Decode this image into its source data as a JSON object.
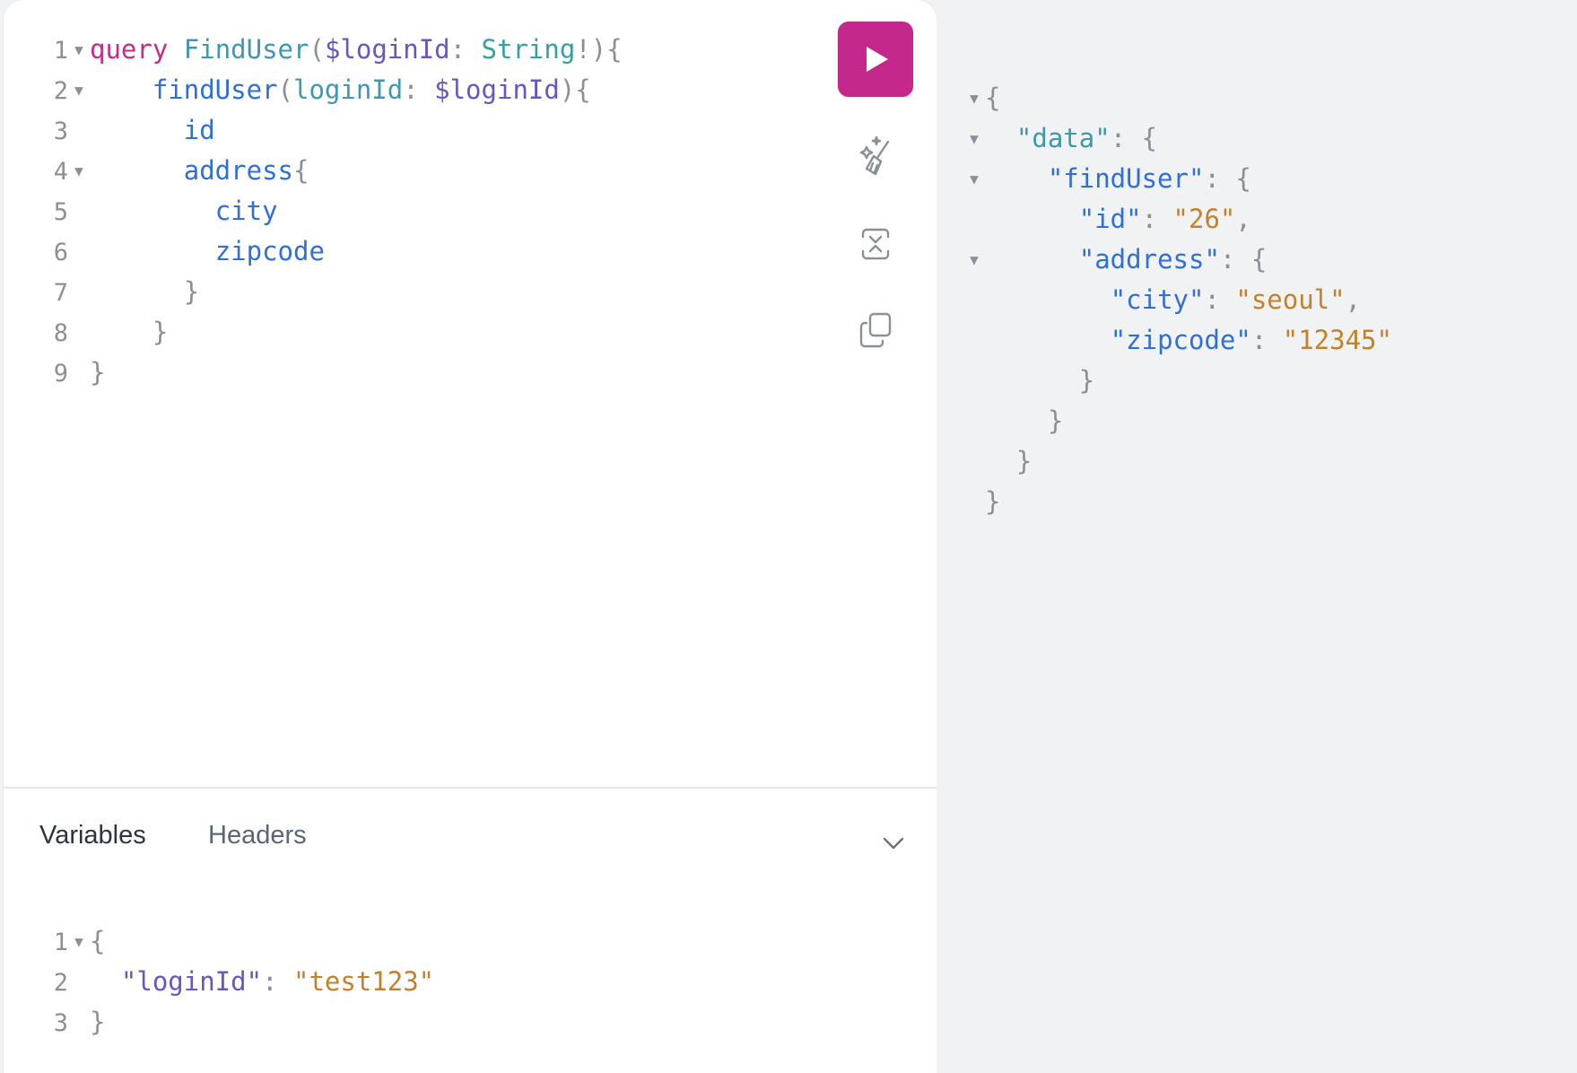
{
  "query_editor": {
    "lines": [
      {
        "n": "1",
        "fold": true,
        "tokens": [
          [
            "kw",
            "query"
          ],
          [
            "plain",
            " "
          ],
          [
            "def",
            "FindUser"
          ],
          [
            "punct",
            "("
          ],
          [
            "var",
            "$loginId"
          ],
          [
            "punct",
            ": "
          ],
          [
            "type",
            "String"
          ],
          [
            "punct",
            "!){"
          ]
        ]
      },
      {
        "n": "2",
        "fold": true,
        "tokens": [
          [
            "plain",
            "    "
          ],
          [
            "field",
            "findUser"
          ],
          [
            "punct",
            "("
          ],
          [
            "def",
            "loginId"
          ],
          [
            "punct",
            ": "
          ],
          [
            "var",
            "$loginId"
          ],
          [
            "punct",
            "){"
          ]
        ]
      },
      {
        "n": "3",
        "fold": false,
        "tokens": [
          [
            "plain",
            "      "
          ],
          [
            "field",
            "id"
          ]
        ]
      },
      {
        "n": "4",
        "fold": true,
        "tokens": [
          [
            "plain",
            "      "
          ],
          [
            "field",
            "address"
          ],
          [
            "punct",
            "{"
          ]
        ]
      },
      {
        "n": "5",
        "fold": false,
        "tokens": [
          [
            "plain",
            "        "
          ],
          [
            "field",
            "city"
          ]
        ]
      },
      {
        "n": "6",
        "fold": false,
        "tokens": [
          [
            "plain",
            "        "
          ],
          [
            "field",
            "zipcode"
          ]
        ]
      },
      {
        "n": "7",
        "fold": false,
        "tokens": [
          [
            "plain",
            "      "
          ],
          [
            "punct",
            "}"
          ]
        ]
      },
      {
        "n": "8",
        "fold": false,
        "tokens": [
          [
            "plain",
            "    "
          ],
          [
            "punct",
            "}"
          ]
        ]
      },
      {
        "n": "9",
        "fold": false,
        "tokens": [
          [
            "punct",
            "}"
          ]
        ]
      }
    ]
  },
  "toolbar": {
    "run_icon": "play-icon",
    "prettify_icon": "magic-wand-icon",
    "merge_icon": "merge-fragments-icon",
    "copy_icon": "copy-icon",
    "run_color": "#c5288c"
  },
  "bottom_tabs": {
    "variables_label": "Variables",
    "headers_label": "Headers",
    "toggle_icon": "chevron-down-icon"
  },
  "variables_editor": {
    "lines": [
      {
        "n": "1",
        "fold": true,
        "tokens": [
          [
            "punct",
            "{"
          ]
        ]
      },
      {
        "n": "2",
        "fold": false,
        "tokens": [
          [
            "plain",
            "  "
          ],
          [
            "key-var",
            "\"loginId\""
          ],
          [
            "punct",
            ": "
          ],
          [
            "str",
            "\"test123\""
          ]
        ]
      },
      {
        "n": "3",
        "fold": false,
        "tokens": [
          [
            "punct",
            "}"
          ]
        ]
      }
    ]
  },
  "results": {
    "lines": [
      {
        "fold": true,
        "tokens": [
          [
            "punct",
            "{"
          ]
        ]
      },
      {
        "fold": true,
        "tokens": [
          [
            "plain",
            "  "
          ],
          [
            "key-data",
            "\"data\""
          ],
          [
            "punct",
            ": {"
          ]
        ]
      },
      {
        "fold": true,
        "tokens": [
          [
            "plain",
            "    "
          ],
          [
            "key-res",
            "\"findUser\""
          ],
          [
            "punct",
            ": {"
          ]
        ]
      },
      {
        "fold": false,
        "tokens": [
          [
            "plain",
            "      "
          ],
          [
            "key-res",
            "\"id\""
          ],
          [
            "punct",
            ": "
          ],
          [
            "str",
            "\"26\""
          ],
          [
            "punct",
            ","
          ]
        ]
      },
      {
        "fold": true,
        "tokens": [
          [
            "plain",
            "      "
          ],
          [
            "key-res",
            "\"address\""
          ],
          [
            "punct",
            ": {"
          ]
        ]
      },
      {
        "fold": false,
        "tokens": [
          [
            "plain",
            "        "
          ],
          [
            "key-res",
            "\"city\""
          ],
          [
            "punct",
            ": "
          ],
          [
            "str",
            "\"seoul\""
          ],
          [
            "punct",
            ","
          ]
        ]
      },
      {
        "fold": false,
        "tokens": [
          [
            "plain",
            "        "
          ],
          [
            "key-res",
            "\"zipcode\""
          ],
          [
            "punct",
            ": "
          ],
          [
            "str",
            "\"12345\""
          ]
        ]
      },
      {
        "fold": false,
        "tokens": [
          [
            "plain",
            "      "
          ],
          [
            "punct",
            "}"
          ]
        ]
      },
      {
        "fold": false,
        "tokens": [
          [
            "plain",
            "    "
          ],
          [
            "punct",
            "}"
          ]
        ]
      },
      {
        "fold": false,
        "tokens": [
          [
            "plain",
            "  "
          ],
          [
            "punct",
            "}"
          ]
        ]
      },
      {
        "fold": false,
        "tokens": [
          [
            "punct",
            "}"
          ]
        ]
      }
    ]
  }
}
